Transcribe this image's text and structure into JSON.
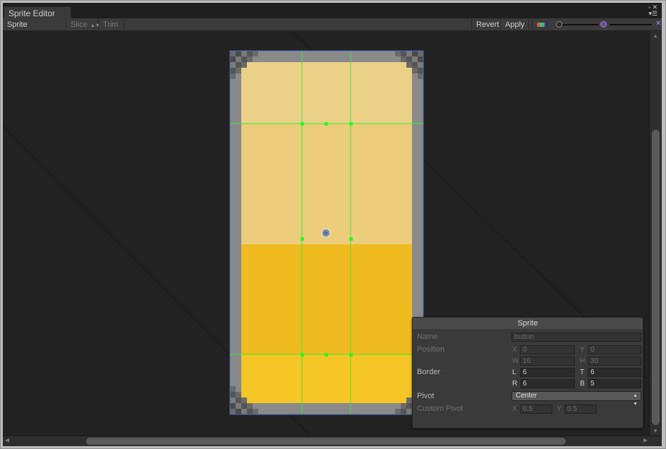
{
  "window": {
    "tab_title": "Sprite Editor"
  },
  "toolbar": {
    "mode_label": "Sprite Editor",
    "slice_label": "Slice",
    "trim_label": "Trim",
    "revert_label": "Revert",
    "apply_label": "Apply",
    "channels_icon": "rgb-channels-icon",
    "zoom_icon": "zoom-slider-icon",
    "mip_icon": "mip-level-icon"
  },
  "sprite_panel": {
    "title": "Sprite",
    "name_label": "Name",
    "name_value": "button",
    "position_label": "Position",
    "pos_x_label": "X",
    "pos_x": "0",
    "pos_y_label": "Y",
    "pos_y": "0",
    "pos_w_label": "W",
    "pos_w": "16",
    "pos_h_label": "H",
    "pos_h": "30",
    "border_label": "Border",
    "border_l_label": "L",
    "border_l": "6",
    "border_t_label": "T",
    "border_t": "6",
    "border_r_label": "R",
    "border_r": "6",
    "border_b_label": "B",
    "border_b": "5",
    "pivot_label": "Pivot",
    "pivot_value": "Center",
    "custom_pivot_label": "Custom Pivot",
    "custom_x_label": "X",
    "custom_x": "0.5",
    "custom_y_label": "Y",
    "custom_y": "0.5"
  },
  "colors": {
    "canvas_bg": "#222222",
    "guide_green": "#33ee33",
    "sprite_light": "#ebcd7c",
    "sprite_dark": "#f0bb20",
    "frame_gray": "#8a8a8a",
    "selection_blue": "#4a6ec8"
  }
}
